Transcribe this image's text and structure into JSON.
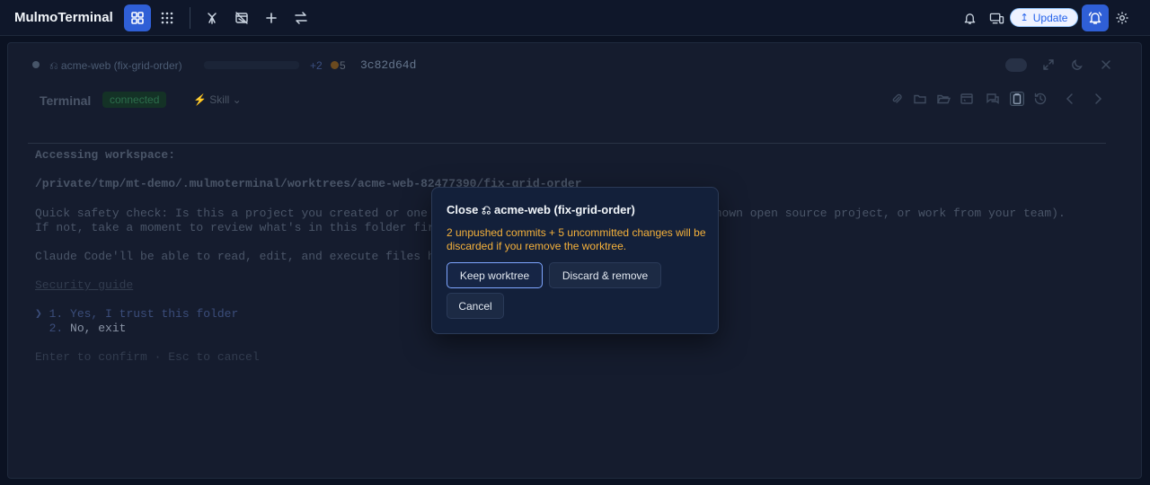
{
  "app": {
    "title": "MulmoTerminal"
  },
  "topbar": {
    "update_label": "Update",
    "icons": [
      "grid-view-icon",
      "grid-dots-icon",
      "merge-icon",
      "no-branch-icon",
      "plus-icon",
      "swap-icon",
      "bell-icon",
      "devices-icon",
      "bell-ring-icon",
      "gear-icon"
    ]
  },
  "tab": {
    "name": "⎌ acme-web (fix-grid-order)",
    "ahead": "+2",
    "changes": "5",
    "commit_hash": "3c82d64d"
  },
  "terminal_header": {
    "title": "Terminal",
    "status": "connected",
    "skill_label": "Skill"
  },
  "terminal": {
    "line1": "Accessing workspace:",
    "line2": "/private/tmp/mt-demo/.mulmoterminal/worktrees/acme-web-82477390/fix-grid-order",
    "line3": "Quick safety check: Is this a project you created or one you trust? (Like your own code, a well-known open source project, or work from your team).",
    "line4": "If not, take a moment to review what's in this folder first.",
    "line5": "Claude Code'll be able to read, edit, and execute files here.",
    "line6": "Security guide",
    "option1": "❯ 1. Yes, I trust this folder",
    "option2_num": "  2. ",
    "option2_text": "No, exit",
    "footer": "Enter to confirm · Esc to cancel"
  },
  "modal": {
    "title": "Close ⎌ acme-web (fix-grid-order)",
    "warning": "2 unpushed commits + 5 uncommitted changes will be discarded if you remove the worktree.",
    "keep_label": "Keep worktree",
    "discard_label": "Discard & remove",
    "cancel_label": "Cancel"
  },
  "colors": {
    "accent": "#2f5fd6",
    "warning": "#f5b13a",
    "connected": "#2c6e4c"
  }
}
